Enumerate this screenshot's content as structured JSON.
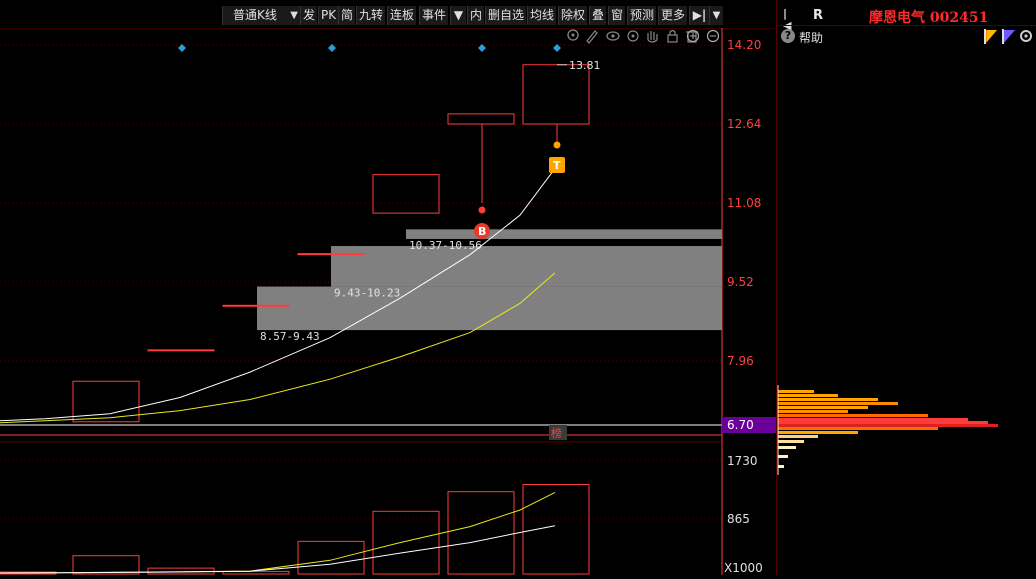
{
  "toolbar": {
    "period_select": "普通K线",
    "buttons": [
      "发",
      "PK",
      "简",
      "九转",
      "连板",
      "事件",
      "内",
      "删自选",
      "均线",
      "除权",
      "叠",
      "窗",
      "预测",
      "更多"
    ]
  },
  "stock": {
    "name": "摩恩电气",
    "code": "002451"
  },
  "right_panel": {
    "r_label": "R",
    "help_label": "帮助"
  },
  "chart_data": {
    "type": "candlestick",
    "price_axis": {
      "ticks": [
        "14.20",
        "12.64",
        "11.08",
        "9.52",
        "7.96",
        "6.70"
      ],
      "current_price": "6.70"
    },
    "candles": [
      {
        "open": 6.76,
        "close": 7.56
      },
      {
        "open": 8.18,
        "close": 8.18
      },
      {
        "open": 9.06,
        "close": 9.06
      },
      {
        "open": 10.08,
        "close": 10.08
      },
      {
        "open": 10.88,
        "close": 11.64
      },
      {
        "open": 12.84,
        "close": 12.64,
        "high": 12.64,
        "low": 11.08
      },
      {
        "open": 12.64,
        "close": 13.81,
        "high": 13.81,
        "low": 12.64
      }
    ],
    "ma_white": [
      6.78,
      6.82,
      6.92,
      7.24,
      7.74,
      8.42,
      9.2,
      10.06,
      10.84,
      11.76
    ],
    "ma_yellow": [
      6.74,
      6.78,
      6.84,
      6.98,
      7.2,
      7.6,
      8.04,
      8.52,
      9.1,
      9.7
    ],
    "gap_zones": [
      {
        "label": "8.57-9.43"
      },
      {
        "label": "9.43-10.23"
      },
      {
        "label": "10.37-10.56"
      }
    ],
    "high_label": "13.81",
    "signals": [
      "B",
      "T"
    ],
    "rank_label": "榜",
    "volume_axis": {
      "ticks": [
        "1730",
        "865"
      ],
      "unit": "X1000"
    },
    "volume": [
      60,
      560,
      180,
      80,
      1000,
      1920,
      2520,
      2740,
      2560
    ],
    "vol_ma_yellow": [
      30,
      40,
      60,
      90,
      420,
      960,
      1450,
      1960,
      2500
    ],
    "vol_ma_white": [
      30,
      38,
      55,
      85,
      300,
      640,
      960,
      1270,
      1480
    ]
  },
  "colors": {
    "up": "#ff3b3b",
    "gap": "#808080",
    "ma_white": "#ffffff",
    "ma_yellow": "#e8e820",
    "axis_text": "#ff4040",
    "price_tag_bg": "#6a0099"
  }
}
